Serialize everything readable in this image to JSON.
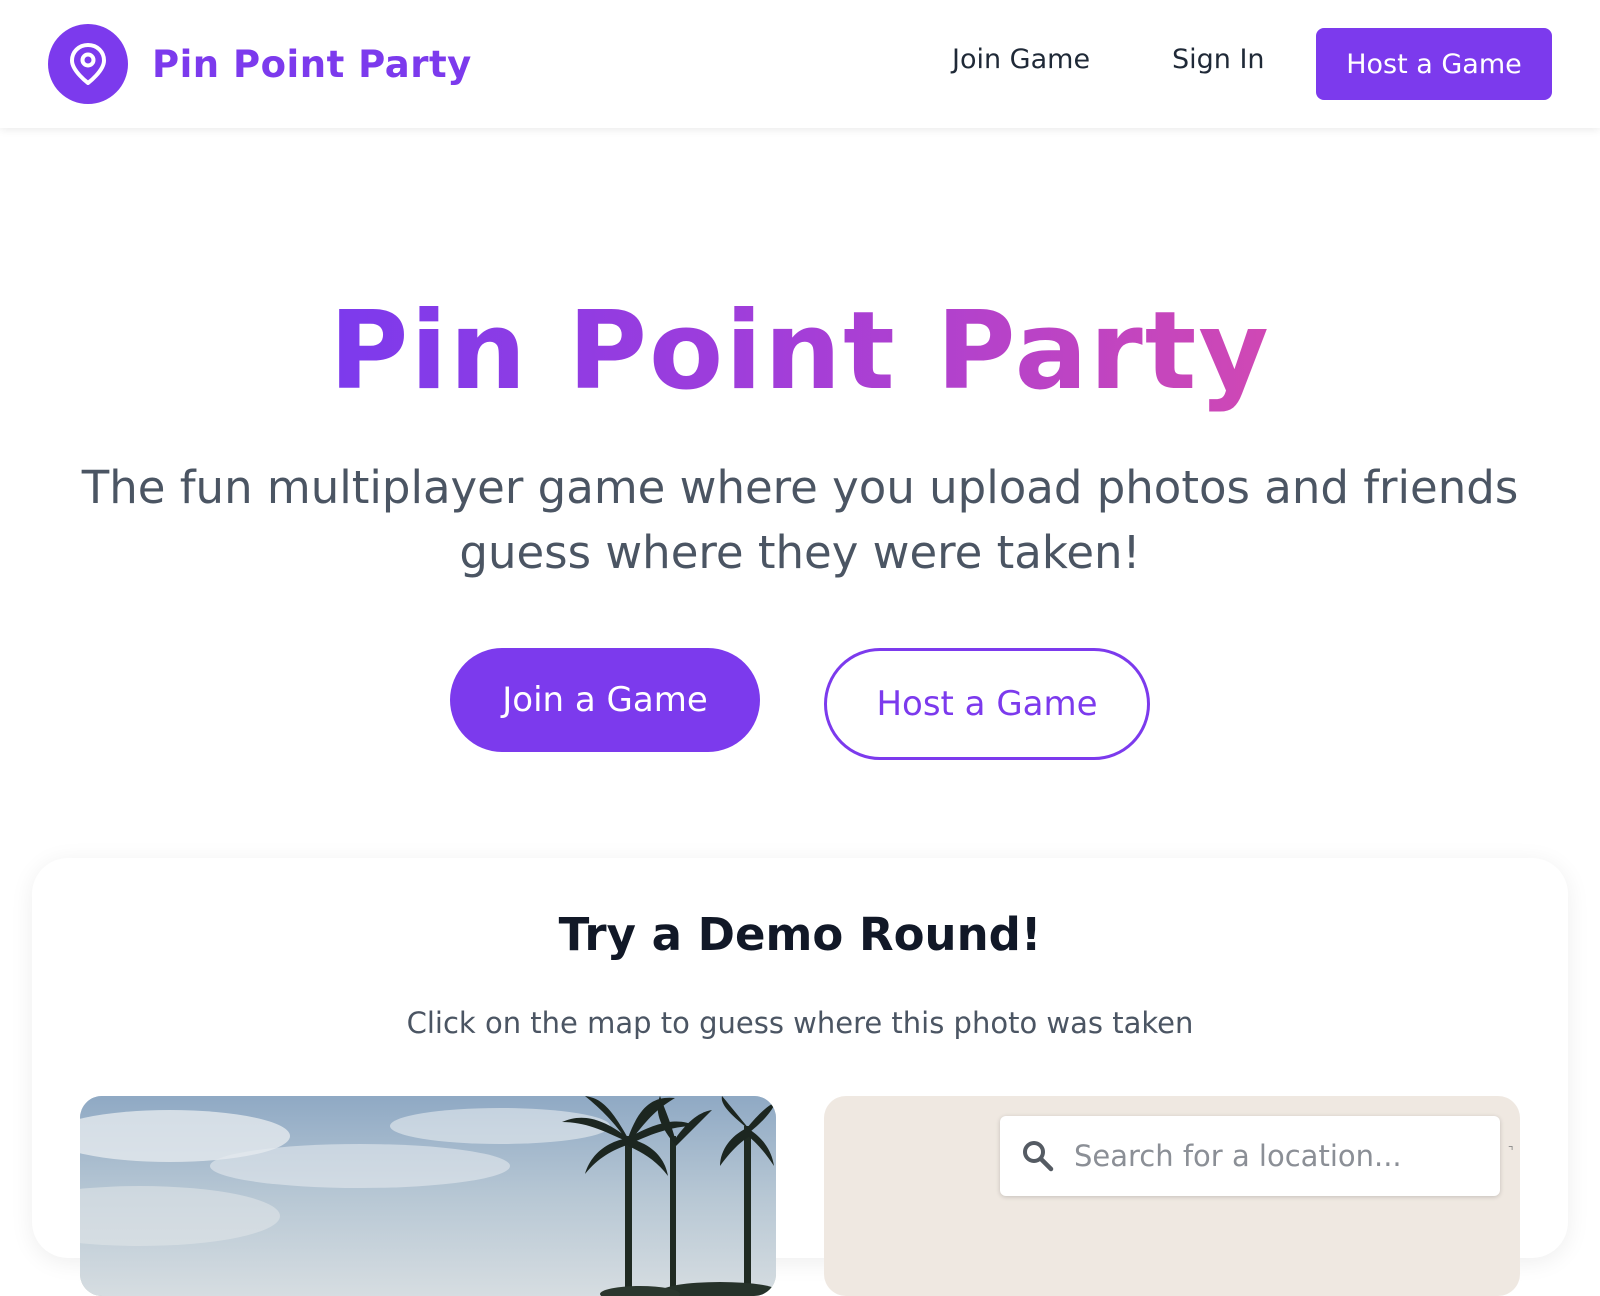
{
  "nav": {
    "brand_name": "Pin Point Party",
    "links": [
      {
        "label": "Join Game"
      },
      {
        "label": "Sign In"
      }
    ],
    "host_button": "Host a Game"
  },
  "hero": {
    "title": "Pin Point Party",
    "subtitle": "The fun multiplayer game where you upload photos and friends guess where they were taken!",
    "join_button": "Join a Game",
    "host_button": "Host a Game"
  },
  "demo": {
    "title": "Try a Demo Round!",
    "subtitle": "Click on the map to guess where this photo was taken",
    "map_search": {
      "placeholder": "Search for a location...",
      "value": ""
    }
  },
  "colors": {
    "accent": "#7c3aed",
    "gradient_end": "#d048b4",
    "text_dark": "#111827",
    "text_muted": "#4b5563",
    "map_background": "#efe8e1"
  },
  "icons": {
    "brand": "map-pin-icon",
    "search": "search-icon"
  }
}
